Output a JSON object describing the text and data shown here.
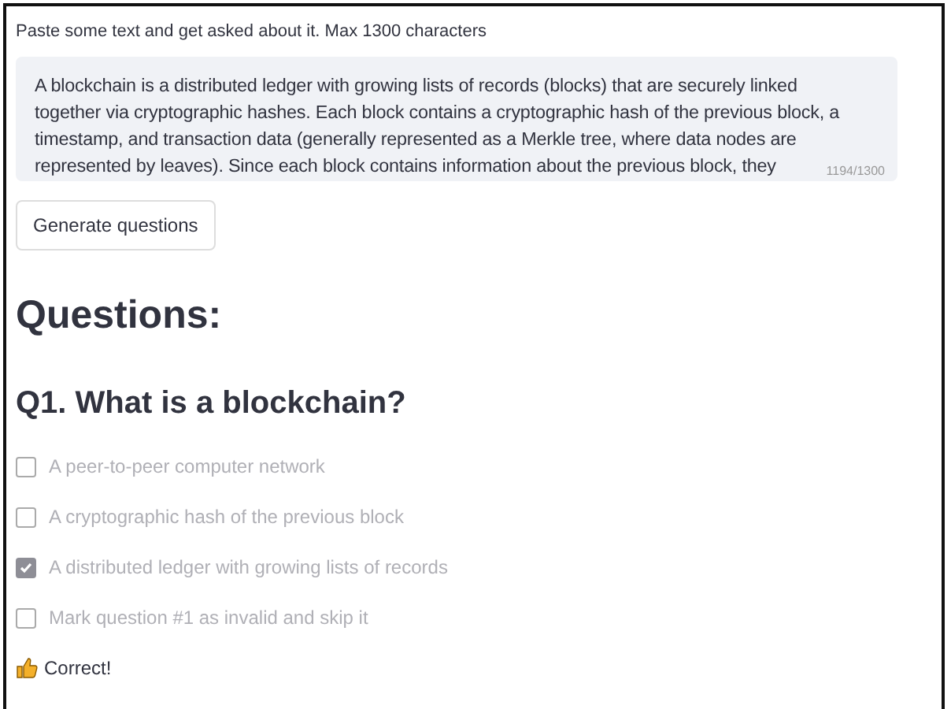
{
  "prompt_label": "Paste some text and get asked about it. Max 1300 characters",
  "text_area": {
    "value": "A blockchain is a distributed ledger with growing lists of records (blocks) that are securely linked together via cryptographic hashes. Each block contains a cryptographic hash of the previous block, a timestamp, and transaction data (generally represented as a Merkle tree, where data nodes are represented by leaves). Since each block contains information about the previous block, they",
    "counter": "1194/1300"
  },
  "generate_button": "Generate questions",
  "questions_heading": "Questions:",
  "question": {
    "title": "Q1. What is a blockchain?",
    "options": [
      {
        "label": "A peer-to-peer computer network",
        "checked": false,
        "disabled": true
      },
      {
        "label": "A cryptographic hash of the previous block",
        "checked": false,
        "disabled": true
      },
      {
        "label": "A distributed ledger with growing lists of records",
        "checked": true,
        "disabled": true
      },
      {
        "label": "Mark question #1 as invalid and skip it",
        "checked": false,
        "disabled": true
      }
    ],
    "feedback": {
      "kind": "correct",
      "text": "Correct!"
    }
  }
}
